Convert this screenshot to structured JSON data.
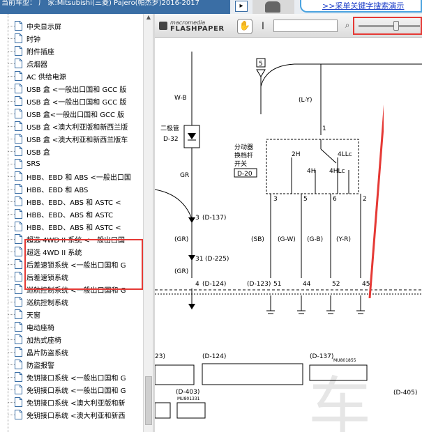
{
  "topbar": {
    "title": "当前车型： 厂 家:Mitsubishi(三菱) Pajero(帕杰罗)2016-2017",
    "nav_arrow": "▸",
    "link": ">>采单关键字搜索演示"
  },
  "tree": {
    "items": [
      "中央显示屏",
      "时钟",
      "附件插座",
      "点烟器",
      "AC 供给电源",
      "USB 盒 <一般出口国和 GCC 版",
      "USB 盒 <一般出口国和 GCC 版",
      "USB 盒<一般出口国和 GCC 版",
      "USB 盒 <澳大利亚版和新西兰版",
      "USB 盒 <澳大利亚和新西兰版车",
      "USB 盒",
      "SRS",
      "HBB、EBD 和 ABS <一般出口国",
      "HBB、EBD 和 ABS",
      "HBB、EBD、ABS 和 ASTC <",
      "HBB、EBD、ABS 和 ASTC",
      "HBB、EBD、ABS 和 ASTC <",
      "超选 4WD II 系统 <一般出口国",
      "超选 4WD II 系统",
      "后差速锁系统 <一般出口国和 G",
      "后差速锁系统",
      "巡航控制系统 <一般出口国和 G",
      "巡航控制系统",
      "天窗",
      "电动座椅",
      "加热式座椅",
      "晶片防盗系统",
      "防盗报警",
      "免钥接口系统 <一般出口国和 G",
      "免钥接口系统 <一般出口国和 G",
      "免钥接口系统 <澳大利亚版和新",
      "免钥接口系统 <澳大利亚和新西"
    ]
  },
  "viewer": {
    "logo_line1": "macromedia",
    "logo_line2": "FLASHPAPER",
    "hand_icon_glyph": "✋",
    "text_tool_glyph": "I",
    "search_glyph": "⌕"
  },
  "diagram": {
    "labels": {
      "conn5": "5",
      "wb": "W-B",
      "ly": "(L-Y)",
      "diode_title": "二极管",
      "d32": "D-32",
      "pin1": "1",
      "switch_title1": "分动器",
      "switch_title2": "换档杆",
      "switch_title3": "开关",
      "d20": "D-20",
      "h2": "2H",
      "h4llc": "4LLc",
      "h4h": "4H",
      "h4hlc": "4HLc",
      "gr": "GR",
      "pin3": "3",
      "d137a": "(D-137)",
      "pin3b": "3",
      "pin5": "5",
      "pin6": "6",
      "pin2": "2",
      "gr_paren": "(GR)",
      "sb": "(SB)",
      "gw": "(G-W)",
      "gb": "(G-B)",
      "yr": "(Y-R)",
      "pin31": "31",
      "d225": "(D-225)",
      "gr_paren2": "(GR)",
      "pin4": "4",
      "d124a": "(D-124)",
      "d123": "(D-123)",
      "pin51": "51",
      "pin44": "44",
      "pin52": "52",
      "pin45": "45",
      "c23": "23)",
      "d124b": "(D-124)",
      "d137b": "(D-137)",
      "mu801855": "MU801855",
      "d403": "(D-403)",
      "mu801331": "MU801331",
      "d405": "(D-405)"
    }
  }
}
